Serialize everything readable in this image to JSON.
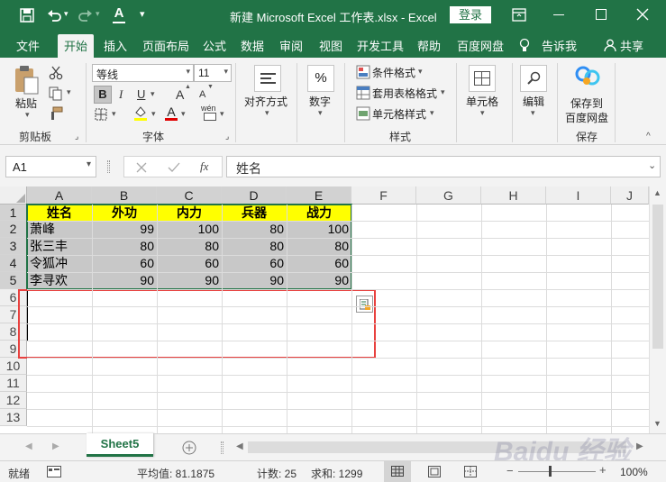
{
  "title_bar": {
    "title": "新建 Microsoft Excel 工作表.xlsx  -  Excel",
    "login_label": "登录"
  },
  "tabs": [
    "文件",
    "开始",
    "插入",
    "页面布局",
    "公式",
    "数据",
    "审阅",
    "视图",
    "开发工具",
    "帮助",
    "百度网盘"
  ],
  "tell_me": "告诉我",
  "share": "共享",
  "ribbon": {
    "clipboard": {
      "paste": "粘贴",
      "group": "剪贴板"
    },
    "font": {
      "name": "等线",
      "size": "11",
      "group": "字体",
      "bold": "B",
      "italic": "I",
      "underline": "U",
      "grow": "A",
      "shrink": "A",
      "font_color": "A",
      "wen": "wén"
    },
    "alignment": {
      "label": "对齐方式"
    },
    "number": {
      "label": "数字",
      "symbol": "%"
    },
    "styles": {
      "conditional": "条件格式",
      "table": "套用表格格式",
      "cell": "单元格样式",
      "group": "样式"
    },
    "cells": {
      "label": "单元格"
    },
    "editing": {
      "label": "编辑"
    },
    "save": {
      "line1": "保存到",
      "line2": "百度网盘",
      "group": "保存"
    }
  },
  "formula_bar": {
    "name_box": "A1",
    "fx": "fx",
    "content": "姓名"
  },
  "columns": [
    "A",
    "B",
    "C",
    "D",
    "E",
    "F",
    "G",
    "H",
    "I",
    "J"
  ],
  "rows": [
    "1",
    "2",
    "3",
    "4",
    "5",
    "6",
    "7",
    "8",
    "9",
    "10",
    "11",
    "12",
    "13"
  ],
  "table": {
    "headers": [
      "姓名",
      "外功",
      "内力",
      "兵器",
      "战力"
    ],
    "rows": [
      [
        "萧峰",
        "99",
        "100",
        "80",
        "100"
      ],
      [
        "张三丰",
        "80",
        "80",
        "80",
        "80"
      ],
      [
        "令狐冲",
        "60",
        "60",
        "60",
        "60"
      ],
      [
        "李寻欢",
        "90",
        "90",
        "90",
        "90"
      ]
    ]
  },
  "sheet_tab": "Sheet5",
  "status": {
    "mode": "就绪",
    "average": "平均值: 81.1875",
    "count": "计数: 25",
    "sum": "求和: 1299",
    "zoom": "100%"
  },
  "watermark": "Baidu 经验",
  "colors": {
    "accent": "#217346",
    "header_fill": "#ffff00",
    "selection_fill": "#c8c8c8",
    "highlight_border": "#e8413f"
  }
}
